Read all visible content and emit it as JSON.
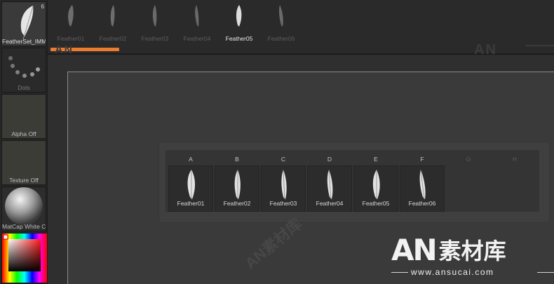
{
  "left_palette": {
    "slots": [
      {
        "label": "FeatherSet_IMM",
        "badge": "6",
        "icon": "feather-icon"
      },
      {
        "label": "Dots",
        "icon": "dots-stroke-icon"
      },
      {
        "label": "Alpha Off",
        "icon": "none"
      },
      {
        "label": "Texture Off",
        "icon": "none"
      },
      {
        "label": "MatCap White C",
        "icon": "matcap-sphere"
      },
      {
        "label": "",
        "icon": "color-picker"
      }
    ]
  },
  "top_strip": {
    "items": [
      {
        "label": "Feather01"
      },
      {
        "label": "Feather02"
      },
      {
        "label": "Feather03"
      },
      {
        "label": "Feather04"
      },
      {
        "label": "Feather05"
      },
      {
        "label": "Feather06"
      }
    ],
    "active_label": "Feather05",
    "watermark": "AN"
  },
  "alpha_panel": {
    "columns": [
      "A",
      "B",
      "C",
      "D",
      "E",
      "F",
      "G",
      "H"
    ],
    "cells": [
      {
        "label": "Feather01"
      },
      {
        "label": "Feather02"
      },
      {
        "label": "Feather03"
      },
      {
        "label": "Feather04"
      },
      {
        "label": "Feather05"
      },
      {
        "label": "Feather06"
      }
    ]
  },
  "logo": {
    "brand": "AN",
    "brand_cn": "素材库",
    "url": "www.ansucai.com",
    "diagonal": "AN素材库"
  },
  "colors": {
    "accent": "#ee7c30",
    "background": "#2e2e2e",
    "panel": "#3f3f3f"
  }
}
